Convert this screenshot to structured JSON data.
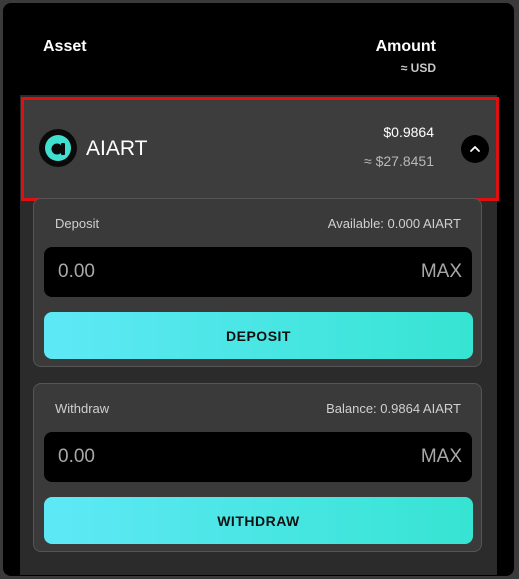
{
  "header": {
    "asset_label": "Asset",
    "amount_label": "Amount",
    "usd_label": "≈ USD"
  },
  "asset": {
    "name": "AIART",
    "icon": "aiart-logo-icon",
    "price": "$0.9864",
    "usd_value": "≈ $27.8451"
  },
  "deposit": {
    "label": "Deposit",
    "available": "Available: 0.000 AIART",
    "input_placeholder": "0.00",
    "max_label": "MAX",
    "button_label": "DEPOSIT"
  },
  "withdraw": {
    "label": "Withdraw",
    "balance": "Balance: 0.9864 AIART",
    "input_placeholder": "0.00",
    "max_label": "MAX",
    "button_label": "WITHDRAW"
  },
  "colors": {
    "accent_start": "#5ee8f6",
    "accent_end": "#36e4d2",
    "highlight_border": "#e01010",
    "logo_accent": "#3fe0cf"
  }
}
